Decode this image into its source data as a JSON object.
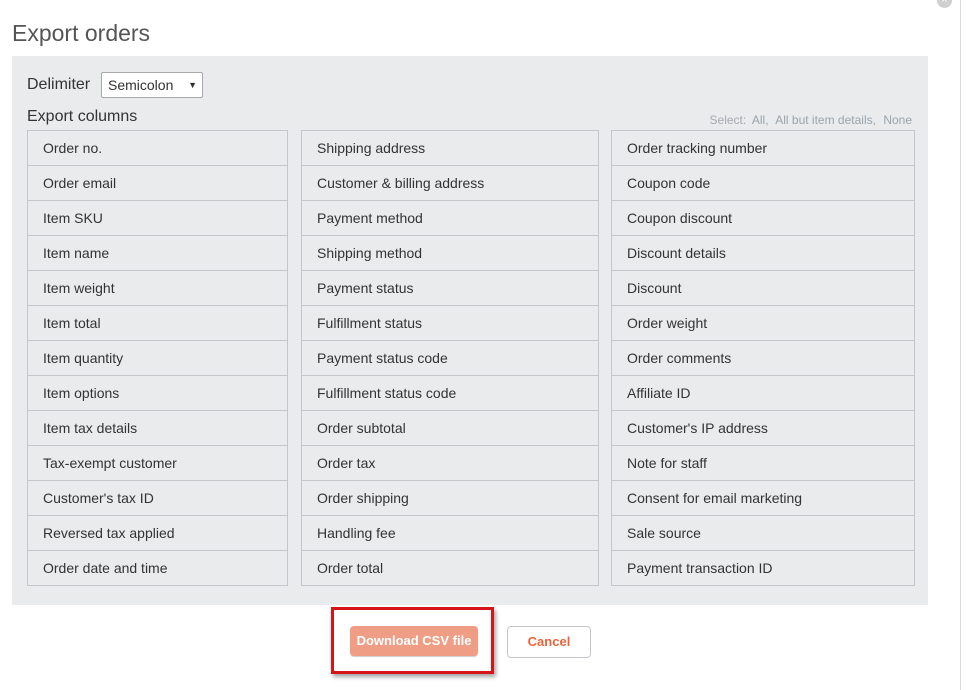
{
  "dialog": {
    "title": "Export orders",
    "close_icon": "×"
  },
  "delimiter": {
    "label": "Delimiter",
    "selected": "Semicolon",
    "arrow": "▼"
  },
  "export_columns": {
    "label": "Export columns",
    "select_label": "Select:",
    "select_links": [
      "All",
      "All but item details",
      "None"
    ],
    "columns": [
      [
        "Order no.",
        "Order email",
        "Item SKU",
        "Item name",
        "Item weight",
        "Item total",
        "Item quantity",
        "Item options",
        "Item tax details",
        "Tax-exempt customer",
        "Customer's tax ID",
        "Reversed tax applied",
        "Order date and time"
      ],
      [
        "Shipping address",
        "Customer & billing address",
        "Payment method",
        "Shipping method",
        "Payment status",
        "Fulfillment status",
        "Payment status code",
        "Fulfillment status code",
        "Order subtotal",
        "Order tax",
        "Order shipping",
        "Handling fee",
        "Order total"
      ],
      [
        "Order tracking number",
        "Coupon code",
        "Coupon discount",
        "Discount details",
        "Discount",
        "Order weight",
        "Order comments",
        "Affiliate ID",
        "Customer's IP address",
        "Note for staff",
        "Consent for email marketing",
        "Sale source",
        "Payment transaction ID"
      ]
    ]
  },
  "actions": {
    "download_label": "Download CSV file",
    "cancel_label": "Cancel"
  },
  "colors": {
    "download_button": "#ef9e85",
    "cancel_text": "#e8653a",
    "highlight_frame": "#d8141b",
    "panel_background": "#e9ebed"
  }
}
